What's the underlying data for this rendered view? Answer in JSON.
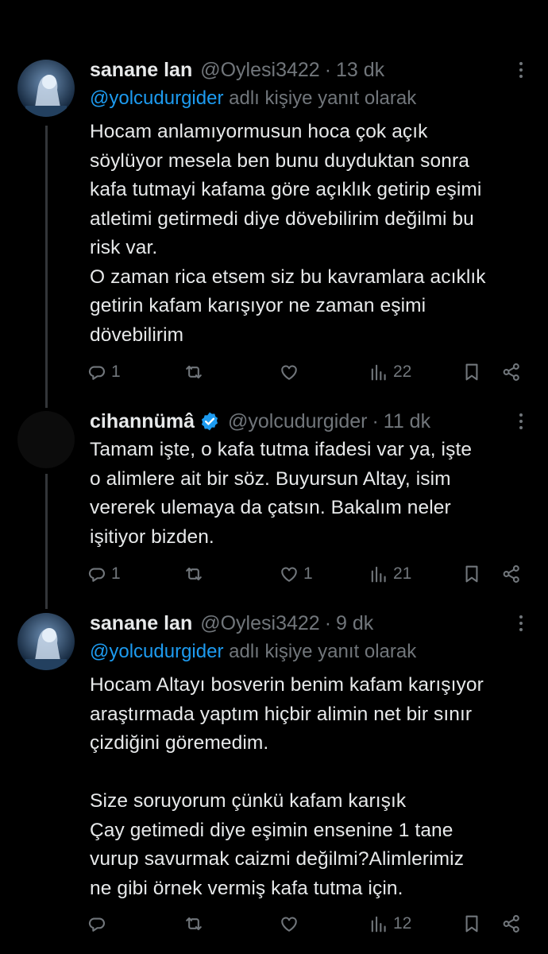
{
  "tweets": [
    {
      "name": "sanane lan",
      "handle": "@Oylesi3422",
      "time": "13 dk",
      "reply_to_mention": "@yolcudurgider",
      "reply_to_suffix": "adlı kişiye yanıt olarak",
      "text": "Hocam anlamıyormusun  hoca çok açık\nsöylüyor mesela ben bunu duyduktan sonra\nkafa tutmayi kafama göre açıklık getirip eşimi\natletimi getirmedi diye dövebilirim değilmi bu\nrisk var.\nO zaman rica etsem siz bu kavramlara acıklık\ngetirin kafam karışıyor ne zaman eşimi\ndövebilirim",
      "replies": "1",
      "retweets": "",
      "likes": "",
      "views": "22"
    },
    {
      "name": "cihannümâ",
      "verified": true,
      "handle": "@yolcudurgider",
      "time": "11 dk",
      "text": "Tamam işte, o kafa tutma ifadesi var ya, işte\no alimlere ait bir söz. Buyursun Altay, isim\nvererek ulemaya da çatsın. Bakalım neler\nişitiyor bizden.",
      "replies": "1",
      "retweets": "",
      "likes": "1",
      "views": "21"
    },
    {
      "name": "sanane lan",
      "handle": "@Oylesi3422",
      "time": "9 dk",
      "reply_to_mention": "@yolcudurgider",
      "reply_to_suffix": "adlı kişiye yanıt olarak",
      "text": "Hocam Altayı bosverin benim kafam karışıyor\naraştırmada yaptım hiçbir alimin net bir sınır\nçizdiğini göremedim.\n\nSize soruyorum çünkü kafam karışık\nÇay getimedi diye eşimin ensenine 1 tane\nvurup savurmak caizmi değilmi?Alimlerimiz\nne gibi örnek vermiş kafa tutma için.",
      "replies": "",
      "retweets": "",
      "likes": "",
      "views": "12"
    }
  ],
  "colors": {
    "background": "#000000",
    "text": "#e7e9ea",
    "muted": "#71767b",
    "accent": "#1d9bf0"
  },
  "icons": [
    "reply-icon",
    "retweet-icon",
    "like-icon",
    "views-icon",
    "bookmark-icon",
    "share-icon",
    "more-icon",
    "verified-icon"
  ]
}
